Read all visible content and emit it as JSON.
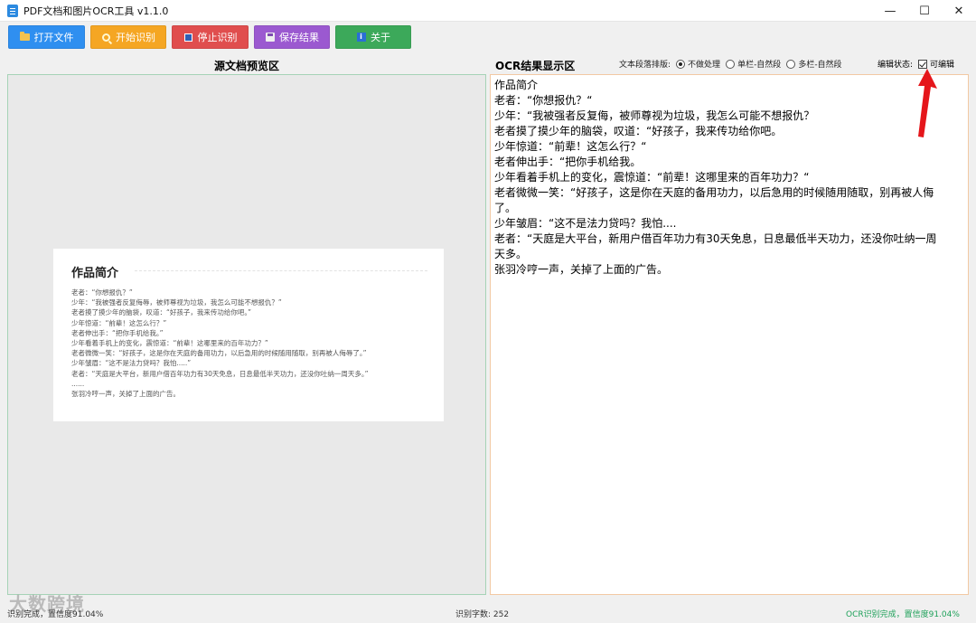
{
  "window": {
    "title": "PDF文档和图片OCR工具 v1.1.0",
    "controls": {
      "minimize": "—",
      "maximize": "☐",
      "close": "✕"
    }
  },
  "toolbar": {
    "open": "打开文件",
    "start": "开始识别",
    "stop": "停止识别",
    "save": "保存结果",
    "about": "关于"
  },
  "left_panel": {
    "header": "源文档预览区",
    "document": {
      "title": "作品简介",
      "lines": [
        "老者：“你想报仇？”",
        "少年：“我被强者反复侮辱，被师尊视为垃圾，我怎么可能不想报仇？”",
        "老者摸了摸少年的脑袋，叹道：“好孩子，我来传功给你吧。”",
        "少年惊道：“前辈！这怎么行？”",
        "老者伸出手：“把你手机给我。”",
        "少年看着手机上的变化，震惊道：“前辈！这哪里来的百年功力？”",
        "老者微微一笑：“好孩子，这是你在天庭的备用功力，以后急用的时候随用随取，别再被人侮辱了。”",
        "少年皱眉：“这不是法力贷吗？我怕.....”",
        "老者：“天庭是大平台，新用户借百年功力有30天免息，日息最低半天功力，还没你吐纳一周天多。”",
        "......",
        "张羽冷哼一声，关掉了上面的广告。"
      ]
    }
  },
  "right_panel": {
    "header": "OCR结果显示区",
    "layout_label": "文本段落排版:",
    "layout_options": [
      "不做处理",
      "单栏-自然段",
      "多栏-自然段"
    ],
    "layout_selected": 0,
    "edit_label": "编辑状态:",
    "edit_checkbox": "可编辑",
    "edit_checked": true,
    "result_lines": [
      "作品简介",
      "老者：“你想报仇？“",
      "少年：“我被强者反复侮，被师尊视为垃圾，我怎么可能不想报仇？",
      "老者摸了摸少年的脑袋，叹道：“好孩子，我来传功给你吧。",
      "少年惊道：“前辈！这怎么行？“",
      "老者伸出手：“把你手机给我。",
      "少年看着手机上的变化，震惊道：“前辈！这哪里来的百年功力？“",
      "老者微微一笑：“好孩子，这是你在天庭的备用功力，以后急用的时候随用随取，别再被人侮",
      "了。",
      "少年皱眉：“这不是法力贷吗？我怕....",
      "老者：“天庭是大平台，新用户借百年功力有30天免息，日息最低半天功力，还没你吐纳一周",
      "天多。",
      "张羽冷哼一声，关掉了上面的广告。"
    ]
  },
  "status": {
    "left": "识别完成，置信度91.04%",
    "count": "识别字数: 252",
    "right": "OCR识别完成，置信度91.04%"
  },
  "watermark": "大数跨境",
  "colors": {
    "open": "#2f8ff0",
    "start": "#f5a623",
    "stop": "#e04e4e",
    "save": "#9b59d0",
    "about": "#3ca95a",
    "status_ok": "#1fa15a",
    "arrow": "#e5161b"
  }
}
